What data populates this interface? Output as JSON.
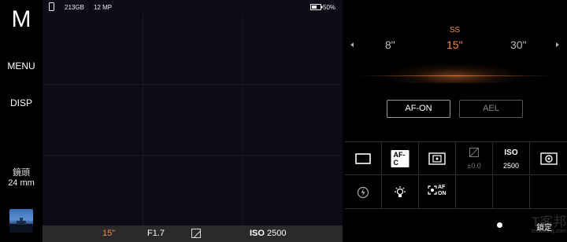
{
  "left_rail": {
    "mode": "M",
    "menu_label": "MENU",
    "disp_label": "DISP",
    "lens_label": "鏡頭",
    "lens_value": "24 mm"
  },
  "status_bar": {
    "storage": "213GB",
    "resolution": "12 MP",
    "battery": "50%"
  },
  "bottom_bar": {
    "shutter": "15\"",
    "aperture": "F1.7",
    "iso_label": "ISO",
    "iso_value": "2500"
  },
  "shutter_dial": {
    "label": "SS",
    "prev": "8\"",
    "current": "15\"",
    "next": "30\""
  },
  "buttons": {
    "af_on": "AF-ON",
    "ael": "AEL"
  },
  "functions": {
    "drive_mode_icon": "single-shot-icon",
    "focus_mode": "AF-C",
    "metering_icon": "metering-icon",
    "ev_value": "±0.0",
    "iso_label": "ISO",
    "iso_value": "2500",
    "white_balance_icon": "wb-icon",
    "flash_icon": "flash-off-icon",
    "dro_icon": "bulb-icon",
    "face_af_label": "AF\nON"
  },
  "lock": {
    "label": "鎖定"
  },
  "watermark": {
    "text": "T客邦",
    "sub": "techbang.com"
  },
  "colors": {
    "accent": "#f08a45",
    "viewfinder_bg": "#0d0c16"
  }
}
